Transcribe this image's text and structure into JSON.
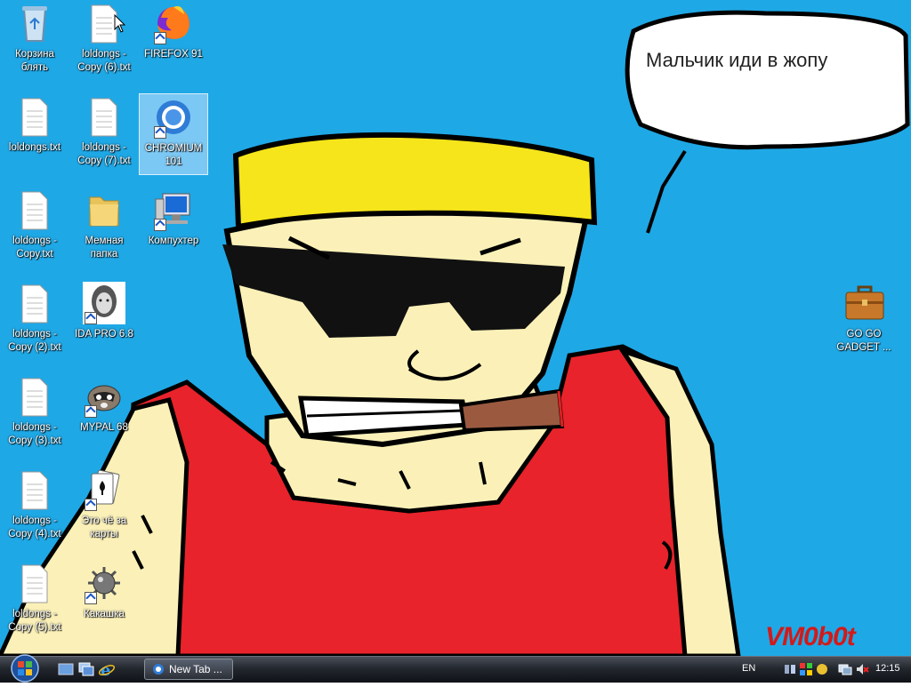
{
  "desktop": {
    "background_color": "#1fa8e6",
    "speech_bubble_text": "Мальчик иди в жопу",
    "signature": "VM0b0t",
    "icons": [
      {
        "label": "Корзина блять",
        "icon": "recycle-bin-icon",
        "selected": false
      },
      {
        "label": "loldongs - Copy (6).txt",
        "icon": "text-file-icon",
        "selected": false
      },
      {
        "label": "FIREFOX 91",
        "icon": "firefox-icon",
        "selected": false
      },
      {
        "label": "loldongs.txt",
        "icon": "text-file-icon",
        "selected": false
      },
      {
        "label": "loldongs - Copy (7).txt",
        "icon": "text-file-icon",
        "selected": false
      },
      {
        "label": "CHROMIUM 101",
        "icon": "chromium-icon",
        "selected": true
      },
      {
        "label": "loldongs - Copy.txt",
        "icon": "text-file-icon",
        "selected": false
      },
      {
        "label": "Мемная папка",
        "icon": "folder-icon",
        "selected": false
      },
      {
        "label": "Компухтер",
        "icon": "computer-icon",
        "selected": false
      },
      {
        "label": "loldongs - Copy (2).txt",
        "icon": "text-file-icon",
        "selected": false
      },
      {
        "label": "IDA PRO 6.8",
        "icon": "ida-pro-icon",
        "selected": false
      },
      {
        "label": "loldongs - Copy (3).txt",
        "icon": "text-file-icon",
        "selected": false
      },
      {
        "label": "MYPAL 68",
        "icon": "mypal-raccoon-icon",
        "selected": false
      },
      {
        "label": "loldongs - Copy (4).txt",
        "icon": "text-file-icon",
        "selected": false
      },
      {
        "label": "Это чё за карты",
        "icon": "playing-cards-icon",
        "selected": false
      },
      {
        "label": "loldongs - Copy (5).txt",
        "icon": "text-file-icon",
        "selected": false
      },
      {
        "label": "Какашка",
        "icon": "minesweeper-mine-icon",
        "selected": false
      },
      {
        "label": "GO GO GADGET ...",
        "icon": "briefcase-icon",
        "selected": false
      }
    ]
  },
  "taskbar": {
    "start_icon": "windows-orb-icon",
    "quick_launch": [
      "show-desktop-icon",
      "switch-windows-icon",
      "internet-explorer-icon"
    ],
    "tasks": [
      {
        "label": "New Tab ...",
        "icon": "chromium-icon"
      }
    ],
    "language": "EN",
    "tray_icons": [
      "network-icon",
      "security-center-icon",
      "sidebar-icon",
      "connection-icon",
      "volume-muted-icon"
    ],
    "clock": "12:15"
  }
}
